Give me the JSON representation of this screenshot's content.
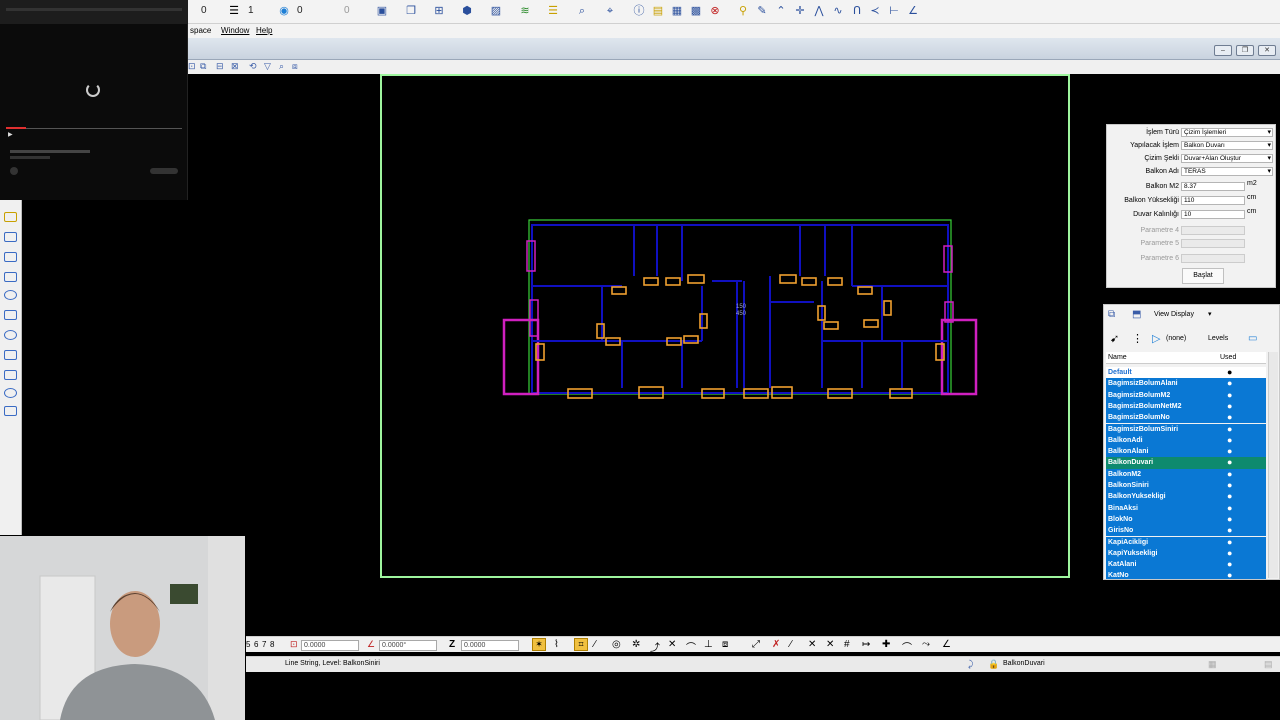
{
  "menu": {
    "workspace": "space",
    "window": "Window",
    "help": "Help"
  },
  "toolbar": {
    "num0": "0",
    "num1": "1",
    "num2": "0",
    "num3": "0"
  },
  "form": {
    "rows": [
      {
        "label": "İşlem Türü",
        "value": "Çizim İşlemleri",
        "kind": "select"
      },
      {
        "label": "Yapılacak İşlem",
        "value": "Balkon Duvarı",
        "kind": "select"
      },
      {
        "label": "Çizim Şekli",
        "value": "Duvar+Alan Oluştur",
        "kind": "select"
      },
      {
        "label": "Balkon Adı",
        "value": "TERAS",
        "kind": "select"
      },
      {
        "label": "Balkon M2",
        "value": "8.37",
        "unit": "m2",
        "kind": "input"
      },
      {
        "label": "Balkon Yüksekliği",
        "value": "110",
        "unit": "cm",
        "kind": "input"
      },
      {
        "label": "Duvar Kalınlığı",
        "value": "10",
        "unit": "cm",
        "kind": "input"
      },
      {
        "label": "Parametre 4",
        "value": "",
        "kind": "disabled"
      },
      {
        "label": "Parametre 5",
        "value": "",
        "kind": "disabled"
      },
      {
        "label": "Parametre 6",
        "value": "",
        "kind": "disabled"
      }
    ],
    "start_button": "Başlat"
  },
  "levels_panel": {
    "view_display": "View Display",
    "filter_none": "(none)",
    "levels_label": "Levels",
    "col_name": "Name",
    "col_used": "Used",
    "rows": [
      {
        "name": "Default",
        "used": "●",
        "style": "default"
      },
      {
        "name": "BagimsizBolumAlani",
        "used": "●",
        "style": "sel"
      },
      {
        "name": "BagimsizBolumM2",
        "used": "●",
        "style": "sel"
      },
      {
        "name": "BagimsizBolumNetM2",
        "used": "●",
        "style": "sel"
      },
      {
        "name": "BagimsizBolumNo",
        "used": "●",
        "style": "sel"
      },
      {
        "name": "BagimsizBolumSiniri",
        "used": "●",
        "style": "sel"
      },
      {
        "name": "BalkonAdi",
        "used": "●",
        "style": "sel"
      },
      {
        "name": "BalkonAlani",
        "used": "●",
        "style": "sel"
      },
      {
        "name": "BalkonDuvari",
        "used": "●",
        "style": "active"
      },
      {
        "name": "BalkonM2",
        "used": "●",
        "style": "sel"
      },
      {
        "name": "BalkonSiniri",
        "used": "●",
        "style": "sel"
      },
      {
        "name": "BalkonYuksekligi",
        "used": "●",
        "style": "sel"
      },
      {
        "name": "BinaAksi",
        "used": "●",
        "style": "sel"
      },
      {
        "name": "BlokNo",
        "used": "●",
        "style": "sel"
      },
      {
        "name": "GirisNo",
        "used": "●",
        "style": "sel"
      },
      {
        "name": "KapiAcikligi",
        "used": "●",
        "style": "sel"
      },
      {
        "name": "KapiYuksekligi",
        "used": "●",
        "style": "sel"
      },
      {
        "name": "KatAlani",
        "used": "●",
        "style": "sel"
      },
      {
        "name": "KatNo",
        "used": "●",
        "style": "sel"
      }
    ]
  },
  "bottom": {
    "views": [
      "5",
      "6",
      "7",
      "8"
    ],
    "x_value": "0.0000",
    "angle_value": "0.0000°",
    "z_label": "Z",
    "z_value": "0.0000"
  },
  "status": {
    "message": "Line String, Level: BalkonSiniri",
    "active_level": "BalkonDuvari"
  },
  "canvas": {
    "dim_top": "150",
    "dim_bottom": "450"
  },
  "colors": {
    "selection": "#0a78d4",
    "active_row": "#0e8a6e",
    "border": "#9ef59e",
    "walls": "#1010c0",
    "windows": "#f0a030",
    "balcony": "#d020c0"
  }
}
